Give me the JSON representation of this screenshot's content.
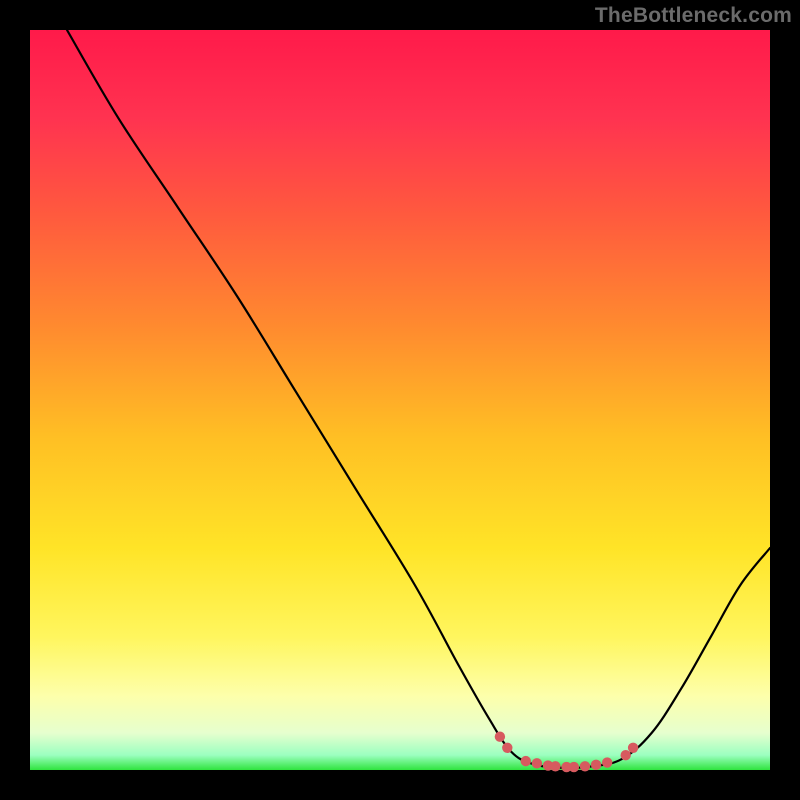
{
  "watermark": {
    "text": "TheBottleneck.com"
  },
  "colors": {
    "frame_bg": "#000000",
    "curve_stroke": "#000000",
    "marker_fill": "#d75a5f",
    "green_band": "#2fe43f",
    "gradient_stops": [
      {
        "pct": 0,
        "color": "#ff1a4a"
      },
      {
        "pct": 12,
        "color": "#ff3350"
      },
      {
        "pct": 25,
        "color": "#ff5a3e"
      },
      {
        "pct": 40,
        "color": "#ff8a2f"
      },
      {
        "pct": 55,
        "color": "#ffbf24"
      },
      {
        "pct": 70,
        "color": "#ffe427"
      },
      {
        "pct": 82,
        "color": "#fff65e"
      },
      {
        "pct": 90,
        "color": "#fdffab"
      },
      {
        "pct": 95,
        "color": "#e6ffce"
      },
      {
        "pct": 98,
        "color": "#9bffc0"
      },
      {
        "pct": 100,
        "color": "#2fe43f"
      }
    ]
  },
  "chart_data": {
    "type": "line",
    "title": "",
    "xlabel": "",
    "ylabel": "",
    "xlim": [
      0,
      100
    ],
    "ylim": [
      0,
      100
    ],
    "description": "Bottleneck curve: V-shaped, minimum near x≈72. Left arm starts near (5,100), descends roughly linearly to zero around x≈67; flat near-zero segment to x≈80; right arm rises with curvature to ≈(100,30). Dotted markers cluster along the flat trough.",
    "series": [
      {
        "name": "bottleneck_curve",
        "points": [
          {
            "x": 5,
            "y": 100
          },
          {
            "x": 12,
            "y": 88
          },
          {
            "x": 20,
            "y": 76
          },
          {
            "x": 28,
            "y": 64
          },
          {
            "x": 36,
            "y": 51
          },
          {
            "x": 44,
            "y": 38
          },
          {
            "x": 52,
            "y": 25
          },
          {
            "x": 58,
            "y": 14
          },
          {
            "x": 62,
            "y": 7
          },
          {
            "x": 65,
            "y": 2.5
          },
          {
            "x": 68,
            "y": 0.8
          },
          {
            "x": 72,
            "y": 0.3
          },
          {
            "x": 76,
            "y": 0.5
          },
          {
            "x": 80,
            "y": 1.5
          },
          {
            "x": 84,
            "y": 5
          },
          {
            "x": 88,
            "y": 11
          },
          {
            "x": 92,
            "y": 18
          },
          {
            "x": 96,
            "y": 25
          },
          {
            "x": 100,
            "y": 30
          }
        ]
      }
    ],
    "markers": [
      {
        "x": 63.5,
        "y": 4.5
      },
      {
        "x": 64.5,
        "y": 3.0
      },
      {
        "x": 67.0,
        "y": 1.2
      },
      {
        "x": 68.5,
        "y": 0.9
      },
      {
        "x": 70.0,
        "y": 0.6
      },
      {
        "x": 71.0,
        "y": 0.5
      },
      {
        "x": 72.5,
        "y": 0.4
      },
      {
        "x": 73.5,
        "y": 0.4
      },
      {
        "x": 75.0,
        "y": 0.5
      },
      {
        "x": 76.5,
        "y": 0.7
      },
      {
        "x": 78.0,
        "y": 1.0
      },
      {
        "x": 80.5,
        "y": 2.0
      },
      {
        "x": 81.5,
        "y": 3.0
      }
    ]
  }
}
